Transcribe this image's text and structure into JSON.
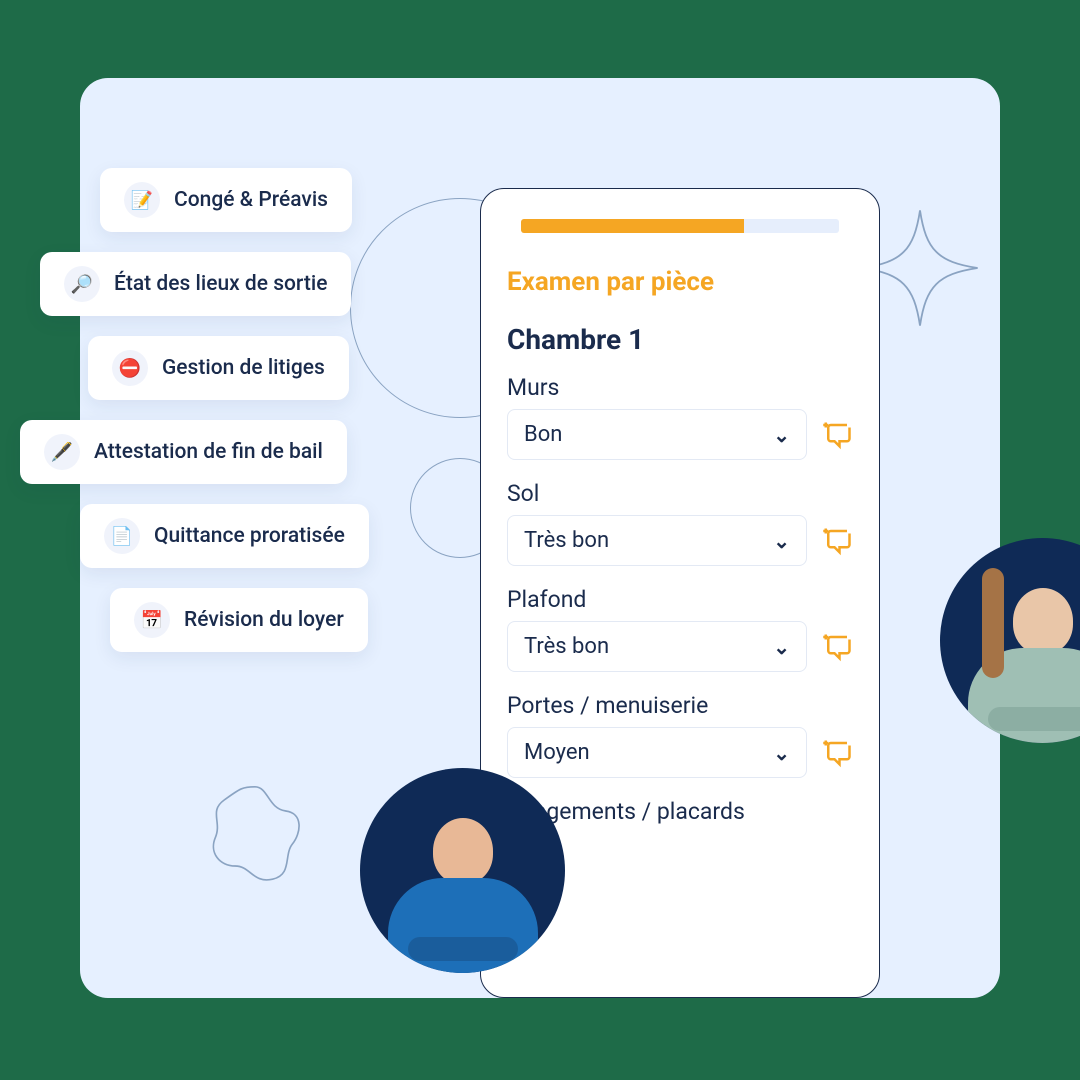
{
  "features": [
    {
      "icon": "📝",
      "label": "Congé & Préavis"
    },
    {
      "icon": "🔎",
      "label": "État des lieux de sortie"
    },
    {
      "icon": "⛔",
      "label": "Gestion de litiges"
    },
    {
      "icon": "🖋️",
      "label": "Attestation de fin de bail"
    },
    {
      "icon": "📄",
      "label": "Quittance proratisée"
    },
    {
      "icon": "📅",
      "label": "Révision du loyer"
    }
  ],
  "phone": {
    "progress_pct": 70,
    "section_title": "Examen par pièce",
    "room_title": "Chambre 1",
    "fields": [
      {
        "label": "Murs",
        "value": "Bon"
      },
      {
        "label": "Sol",
        "value": "Très bon"
      },
      {
        "label": "Plafond",
        "value": "Très bon"
      },
      {
        "label": "Portes / menuiserie",
        "value": "Moyen"
      },
      {
        "label": "Rangements / placards",
        "value": ""
      }
    ]
  },
  "colors": {
    "accent": "#f5a623",
    "ink": "#1a2b4c",
    "panel": "#e6f0ff",
    "bg": "#1e6b48"
  }
}
